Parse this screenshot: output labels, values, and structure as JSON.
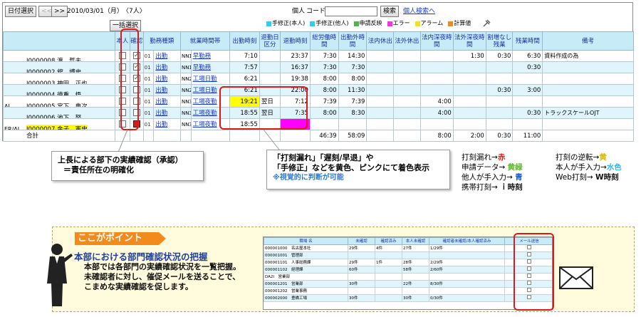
{
  "toolbar": {
    "date_select_label": "日付選択",
    "prev_label": "<<",
    "next_label": ">>",
    "date": "2010/03/01（月）",
    "count": "〈7人〉",
    "personal_label": "個人",
    "code_label": "コード",
    "code_value": "",
    "search_label": "検索",
    "personal_search_label": "個人検索へ",
    "bulk_select_label": "一括選択"
  },
  "legend": [
    {
      "label": "手修正(本人)",
      "color": "#38c8f0"
    },
    {
      "label": "手修正(他人)",
      "color": "#38c8f0"
    },
    {
      "label": "申請反映",
      "color": "#4ab848"
    },
    {
      "label": "エラー",
      "color": "#e838e8"
    },
    {
      "label": "アラーム",
      "color": "#f0e028"
    },
    {
      "label": "計算値",
      "color": "#f08828"
    }
  ],
  "colors": {
    "header_bg": "#c7ecf7",
    "row_alt": "#dff5fb",
    "highlight_yellow": "#ffff00",
    "error_magenta": "#ff00ff",
    "accent_red": "#e01818",
    "point_orange": "#f28a1c"
  },
  "grid": {
    "headers": [
      "本人",
      "確認",
      "勤務種類",
      "就業時間帯",
      "出勤時刻",
      "退勤日区分",
      "退勤時刻",
      "総労働時間",
      "出勤外時間",
      "法内休出",
      "法外休出",
      "法内深夜時間",
      "法外深夜時間",
      "割増なし残業",
      "残業時間",
      "備考"
    ],
    "rows": [
      {
        "pre": "",
        "emp": "I0000008 渡　哲夫",
        "conf": true,
        "code": "01",
        "kind": "出勤",
        "nn": "NN1",
        "shift": "早勤務",
        "in": "7:10",
        "outday": "",
        "out": "23:37",
        "total": "7:30",
        "work": "14:30",
        "c1": "",
        "c2": "",
        "c3": "",
        "c4": "1:30",
        "c5": "0:30",
        "c6": "6:30",
        "note": "資料作成の為"
      },
      {
        "pre": "",
        "emp": "I0000002 舘　博史",
        "conf": true,
        "code": "01",
        "kind": "出勤",
        "nn": "NN1",
        "shift": "早勤務",
        "in": "7:57",
        "outday": "",
        "out": "16:37",
        "total": "7:30",
        "work": "7:30",
        "c1": "",
        "c2": "",
        "c3": "",
        "c4": "",
        "c5": "",
        "c6": "0:30",
        "note": ""
      },
      {
        "pre": "",
        "emp": "I0000003 神田　正也",
        "conf": true,
        "code": "01",
        "kind": "出勤",
        "nn": "NN2",
        "shift": "工場日勤",
        "in": "6:21",
        "outday": "",
        "out": "19:38",
        "total": "8:00",
        "work": "8:00",
        "c1": "",
        "c2": "",
        "c3": "",
        "c4": "",
        "c5": "",
        "c6": "",
        "note": ""
      },
      {
        "pre": "",
        "emp": "I0000004 徳重　悟",
        "conf": false,
        "code": "01",
        "kind": "出勤",
        "nn": "NN2",
        "shift": "工場日勤",
        "in": "6:21",
        "outday": "",
        "out": "22:00",
        "total": "8:00",
        "work": "11:30",
        "c1": "",
        "c2": "",
        "c3": "",
        "c4": "",
        "c5": "0:30",
        "c6": "3:00",
        "note": ""
      },
      {
        "pre": "AL",
        "emp": "I0000005 宮下　典次",
        "conf": false,
        "code": "01",
        "kind": "出勤",
        "nn": "NN3",
        "shift": "工場夜勤",
        "in": "19:21",
        "outday": "翌日",
        "out": "7:12",
        "total": "7:39",
        "work": "7:39",
        "c1": "",
        "c2": "",
        "c3": "4:00",
        "c4": "",
        "c5": "",
        "c6": "",
        "note": ""
      },
      {
        "pre": "",
        "emp": "I0000006 池下　努",
        "conf": false,
        "code": "01",
        "kind": "出勤",
        "nn": "NN3",
        "shift": "工場夜勤",
        "in": "18:55",
        "outday": "翌日",
        "out": "7:35",
        "total": "8:00",
        "work": "8:30",
        "c1": "",
        "c2": "",
        "c3": "4:00",
        "c4": "",
        "c5": "",
        "c6": "0:30",
        "note": "トラックスケールOJT"
      },
      {
        "pre": "ER/AL",
        "emp": "I0000007 金子　憲史",
        "conf": false,
        "code": "01",
        "kind": "出勤",
        "nn": "NN3",
        "shift": "工場夜勤",
        "in": "18:55",
        "outday": "",
        "out": "",
        "total": "",
        "work": "",
        "c1": "",
        "c2": "",
        "c3": "",
        "c4": "",
        "c5": "",
        "c6": "",
        "note": ""
      }
    ],
    "total": {
      "label": "合計",
      "total": "46:39",
      "work": "58:09",
      "c3": "8:00",
      "c4": "2:00",
      "c5": "0:30",
      "c6": "11:00"
    }
  },
  "callouts": {
    "approval": [
      "上長による部下の実績確認（承認）",
      "＝責任所在の明確化"
    ],
    "highlight": [
      "「打刻漏れ」「遅刻/早退」や",
      "「手修正」などを黄色、ピンクにて着色表示"
    ],
    "highlight_note": "※視覚的に判断が可能"
  },
  "rules": {
    "col1": [
      {
        "text": "打刻漏れ→",
        "mark": "赤",
        "color": "#e01818"
      },
      {
        "text": "申請データ→ ",
        "mark": "黄緑",
        "color": "#5cb82a"
      },
      {
        "text": "他人が手入力→ ",
        "mark": "青",
        "color": "#1f5ad8"
      },
      {
        "text": "携帯打刻→ ",
        "mark": "ｉ時刻",
        "color": "#111111"
      }
    ],
    "col2": [
      {
        "text": "打刻の逆転→",
        "mark": "黄",
        "color": "#d8b800"
      },
      {
        "text": "本人が手入力→",
        "mark": "水色",
        "color": "#38b8e8"
      },
      {
        "text": "Web打刻→ ",
        "mark": "W時刻",
        "color": "#111111"
      }
    ]
  },
  "point": {
    "badge": "ここがポイント",
    "title": "本部における部門確認状況の把握",
    "body": [
      "本部では各部門の実績確認状況を一覧把握。",
      "未確認者に対し、催促メールを送ることで、",
      "こまめな実績確認を促します。"
    ]
  },
  "dept_table": {
    "headers": [
      "職場 名",
      "未確認",
      "確認済み",
      "本人未確認",
      "確認者未確認/本人確認済み",
      "メール送信"
    ],
    "rows": [
      {
        "name": "000001000　名古屋本社",
        "a": "29件",
        "b": "4件",
        "c": "27件",
        "d": "1/29件"
      },
      {
        "name": "000001001　管理部",
        "a": "",
        "b": "",
        "c": "",
        "d": ""
      },
      {
        "name": "000001101　人事総務課",
        "a": "29件",
        "b": "1件",
        "c": "28件",
        "d": "2/29件"
      },
      {
        "name": "000001102　経理課",
        "a": "60件",
        "b": "",
        "c": "58件",
        "d": "2/60件"
      },
      {
        "name": "DA2I　営業部",
        "a": "",
        "b": "",
        "c": "",
        "d": ""
      },
      {
        "name": "000001201　営業部",
        "a": "30件",
        "b": "",
        "c": "22件",
        "d": "8/30件"
      },
      {
        "name": "000001202　営業事務",
        "a": "",
        "b": "",
        "c": "",
        "d": ""
      },
      {
        "name": "000002000　豊橋工場",
        "a": "30件",
        "b": "",
        "c": "30件",
        "d": "0/30件"
      }
    ]
  }
}
